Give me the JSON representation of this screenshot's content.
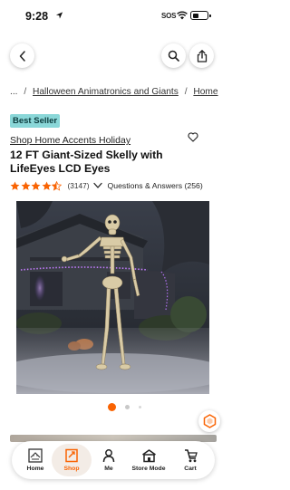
{
  "status_bar": {
    "time": "9:28",
    "sos": "SOS"
  },
  "breadcrumb": {
    "ellipsis": "...",
    "items": [
      "Halloween Animatronics and Giants",
      "Home"
    ]
  },
  "badge": "Best Seller",
  "product": {
    "brand": "Shop Home Accents Holiday",
    "title": "12 FT Giant-Sized Skelly with LifeEyes LCD Eyes",
    "rating": 4.5,
    "review_count": "(3147)",
    "qa_label": "Questions & Answers (256)"
  },
  "carousel": {
    "pages": 3,
    "active": 1
  },
  "nav": {
    "home": "Home",
    "shop": "Shop",
    "me": "Me",
    "store_mode": "Store Mode",
    "cart": "Cart"
  },
  "colors": {
    "accent": "#f96302",
    "badge_bg": "#8ad7d8",
    "star": "#f96302"
  }
}
